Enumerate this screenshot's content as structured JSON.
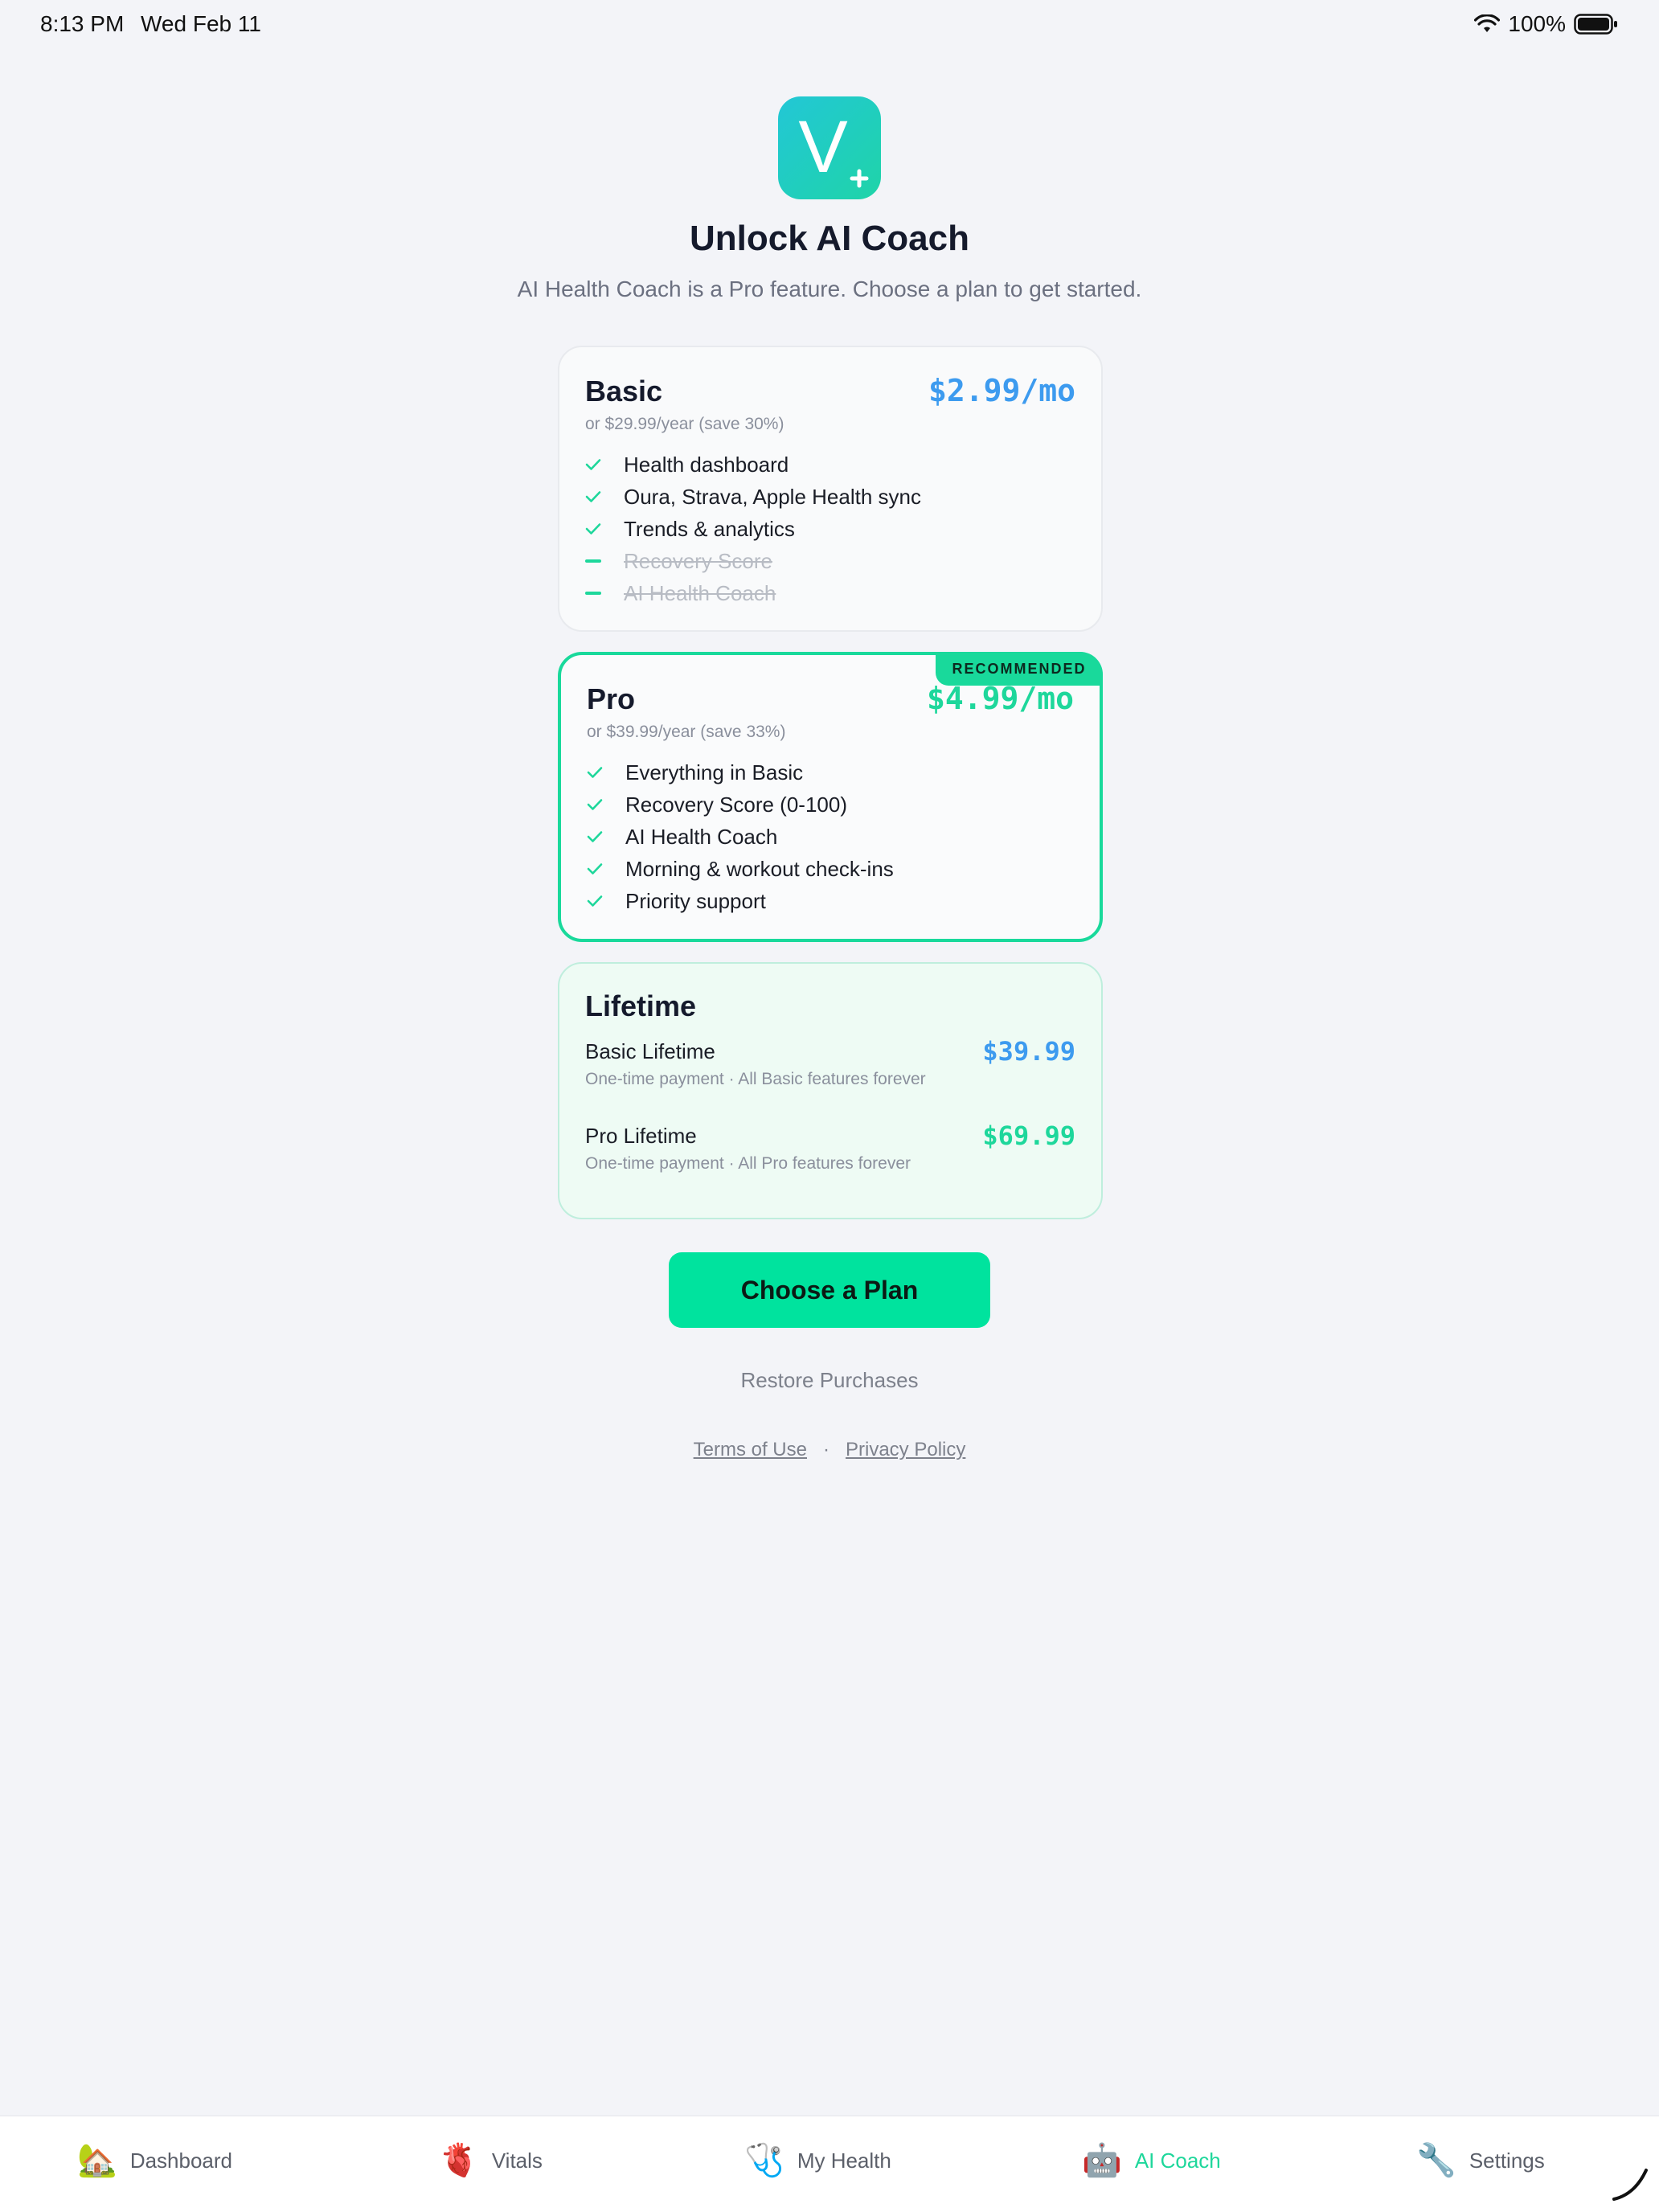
{
  "status": {
    "time": "8:13 PM",
    "date": "Wed Feb 11",
    "battery": "100%"
  },
  "header": {
    "logo_letter": "V",
    "title": "Unlock AI Coach",
    "subtitle": "AI Health Coach is a Pro feature. Choose a plan to get started."
  },
  "plans": {
    "basic": {
      "name": "Basic",
      "price": "$2.99/mo",
      "yearly": "or $29.99/year (save 30%)",
      "features": [
        {
          "text": "Health dashboard",
          "included": true
        },
        {
          "text": "Oura, Strava, Apple Health sync",
          "included": true
        },
        {
          "text": "Trends & analytics",
          "included": true
        },
        {
          "text": "Recovery Score",
          "included": false
        },
        {
          "text": "AI Health Coach",
          "included": false
        }
      ]
    },
    "pro": {
      "badge": "RECOMMENDED",
      "name": "Pro",
      "price": "$4.99/mo",
      "yearly": "or $39.99/year (save 33%)",
      "features": [
        {
          "text": "Everything in Basic",
          "included": true
        },
        {
          "text": "Recovery Score (0-100)",
          "included": true
        },
        {
          "text": "AI Health Coach",
          "included": true
        },
        {
          "text": "Morning & workout check-ins",
          "included": true
        },
        {
          "text": "Priority support",
          "included": true
        }
      ]
    },
    "lifetime": {
      "title": "Lifetime",
      "options": [
        {
          "name": "Basic Lifetime",
          "desc": "One-time payment · All Basic features forever",
          "price": "$39.99"
        },
        {
          "name": "Pro Lifetime",
          "desc": "One-time payment · All Pro features forever",
          "price": "$69.99"
        }
      ]
    }
  },
  "actions": {
    "choose_plan": "Choose a Plan",
    "restore": "Restore Purchases",
    "terms": "Terms of Use",
    "separator": "·",
    "privacy": "Privacy Policy"
  },
  "tabs": [
    {
      "label": "Dashboard",
      "icon": "house-with-garden-icon",
      "glyph": "🏡"
    },
    {
      "label": "Vitals",
      "icon": "anatomical-heart-icon",
      "glyph": "🫀"
    },
    {
      "label": "My Health",
      "icon": "stethoscope-icon",
      "glyph": "🩺"
    },
    {
      "label": "AI Coach",
      "icon": "robot-icon",
      "glyph": "🤖",
      "active": true
    },
    {
      "label": "Settings",
      "icon": "wrench-icon",
      "glyph": "🔧"
    }
  ],
  "colors": {
    "accent_green": "#1ed79b",
    "cta_green": "#00e39e",
    "price_blue": "#3d9bef",
    "background": "#f3f4f8"
  }
}
